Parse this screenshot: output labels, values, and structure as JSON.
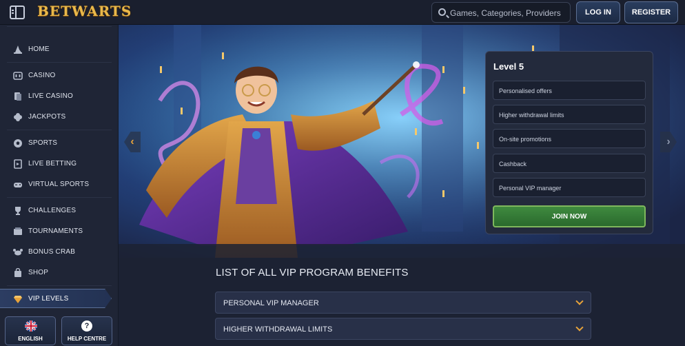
{
  "header": {
    "logo": "BETWARTS",
    "search_placeholder": "Games, Categories, Providers",
    "login_label": "LOG IN",
    "register_label": "REGISTER"
  },
  "sidebar": {
    "items": [
      {
        "label": "HOME",
        "icon": "wizard-hat-icon"
      },
      {
        "label": "CASINO",
        "icon": "slot-machine-icon"
      },
      {
        "label": "LIVE CASINO",
        "icon": "cards-icon"
      },
      {
        "label": "JACKPOTS",
        "icon": "clover-icon"
      },
      {
        "label": "SPORTS",
        "icon": "soccer-ball-icon"
      },
      {
        "label": "LIVE BETTING",
        "icon": "live-betting-icon"
      },
      {
        "label": "VIRTUAL SPORTS",
        "icon": "gamepad-icon"
      },
      {
        "label": "CHALLENGES",
        "icon": "trophy-icon"
      },
      {
        "label": "TOURNAMENTS",
        "icon": "tournament-icon"
      },
      {
        "label": "BONUS CRAB",
        "icon": "crab-icon"
      },
      {
        "label": "SHOP",
        "icon": "shopping-bag-icon"
      }
    ],
    "active_item": {
      "label": "VIP LEVELS",
      "icon": "diamond-icon"
    },
    "language_label": "ENGLISH",
    "help_label": "HELP CENTRE"
  },
  "hero": {
    "level_title": "Level 5",
    "benefits": [
      "Personalised offers",
      "Higher withdrawal limits",
      "On-site promotions",
      "Cashback",
      "Personal VIP manager"
    ],
    "join_label": "JOIN NOW",
    "prev_arrow": "‹",
    "next_arrow": "›"
  },
  "main": {
    "list_title": "LIST OF ALL VIP PROGRAM BENEFITS",
    "accordion": [
      "PERSONAL VIP MANAGER",
      "HIGHER WITHDRAWAL LIMITS"
    ]
  },
  "colors": {
    "accent_gold": "#e8a33a",
    "join_green": "#3f8a3f",
    "sidebar_bg": "#1f2536",
    "page_bg": "#1c2233"
  }
}
